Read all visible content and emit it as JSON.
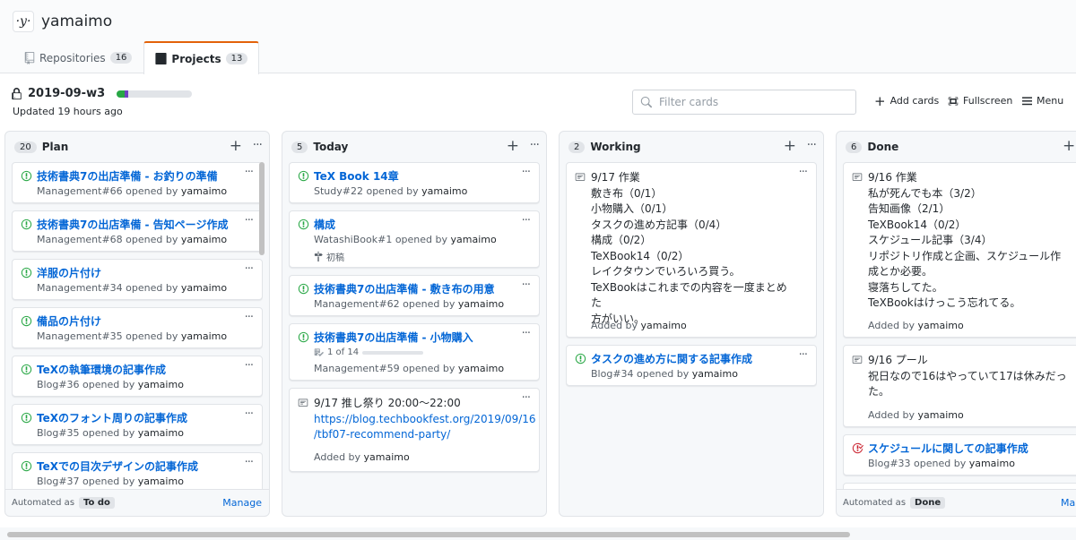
{
  "org": {
    "logo": "·y·",
    "name": "yamaimo"
  },
  "tabs": [
    {
      "label": "Repositories",
      "count": "16",
      "icon": "repo-icon"
    },
    {
      "label": "Projects",
      "count": "13",
      "icon": "project-icon"
    }
  ],
  "project": {
    "name": "2019-09-w3",
    "updated": "Updated 19 hours ago",
    "progress_done_pct": 10,
    "progress_in_progress_pct": 5,
    "colors": {
      "done": "#28a745",
      "in_progress": "#6f42c1",
      "accent": "#e36209",
      "link": "#0366d6",
      "open_issue": "#28a745",
      "closed_issue": "#cb2431"
    }
  },
  "toolbar": {
    "filter_placeholder": "Filter cards",
    "add_cards": "Add cards",
    "fullscreen": "Fullscreen",
    "menu": "Menu"
  },
  "columns": [
    {
      "name": "Plan",
      "count": "20",
      "footer_label": "Automated as",
      "footer_tag": "To do",
      "footer_link": "Manage",
      "cards": [
        {
          "title": "技術書典7の出店準備 - お釣りの準備",
          "ref": "Management#66 opened by",
          "user": "yamaimo"
        },
        {
          "title": "技術書典7の出店準備 - 告知ページ作成",
          "ref": "Management#68 opened by",
          "user": "yamaimo"
        },
        {
          "title": "洋服の片付け",
          "ref": "Management#34 opened by",
          "user": "yamaimo"
        },
        {
          "title": "備品の片付け",
          "ref": "Management#35 opened by",
          "user": "yamaimo"
        },
        {
          "title": "TeXの執筆環境の記事作成",
          "ref": "Blog#36 opened by",
          "user": "yamaimo"
        },
        {
          "title": "TeXのフォント周りの記事作成",
          "ref": "Blog#35 opened by",
          "user": "yamaimo"
        },
        {
          "title": "TeXでの目次デザインの記事作成",
          "ref": "Blog#37 opened by",
          "user": "yamaimo"
        }
      ]
    },
    {
      "name": "Today",
      "count": "5",
      "cards": [
        {
          "title": "TeX Book 14章",
          "ref": "Study#22 opened by",
          "user": "yamaimo"
        },
        {
          "title": "構成",
          "ref": "WatashiBook#1 opened by",
          "user": "yamaimo",
          "milestone": "初稿"
        },
        {
          "title": "技術書典7の出店準備 - 敷き布の用意",
          "ref": "Management#62 opened by",
          "user": "yamaimo"
        },
        {
          "title": "技術書典7の出店準備 - 小物購入",
          "ref": "Management#59 opened by",
          "user": "yamaimo",
          "tasks": "1 of 14"
        },
        {
          "note_lines": [
            "9/17 推し祭り 20:00〜22:00"
          ],
          "link_lines": [
            "https://blog.techbookfest.org/2019/09/16",
            "/tbf07-recommend-party/"
          ],
          "added": "Added by",
          "user": "yamaimo"
        }
      ]
    },
    {
      "name": "Working",
      "count": "2",
      "cards": [
        {
          "note_lines": [
            "9/17 作業",
            "敷き布（0/1）",
            "小物購入（0/1）",
            "タスクの進め方記事（0/4）",
            "構成（0/2）",
            "TeXBook14（0/2）",
            "レイクタウンでいろいろ買う。",
            "TeXBookはこれまでの内容を一度まとめた",
            "方がいい。"
          ],
          "added": "Added by",
          "user": "yamaimo"
        },
        {
          "title": "タスクの進め方に関する記事作成",
          "ref": "Blog#34 opened by",
          "user": "yamaimo"
        }
      ]
    },
    {
      "name": "Done",
      "count": "6",
      "footer_label": "Automated as",
      "footer_tag": "Done",
      "footer_link": "Mar",
      "cards": [
        {
          "note_lines": [
            "9/16 作業",
            "私が死んでも本（3/2）",
            "告知画像（2/1）",
            "TeXBook14（0/2）",
            "スケジュール記事（3/4）",
            "リポジトリ作成と企画、スケジュール作",
            "成とか必要。",
            "寝落ちしてた。",
            "TeXBookはけっこう忘れてる。"
          ],
          "added": "Added by",
          "user": "yamaimo"
        },
        {
          "note_lines": [
            "9/16 プール",
            "祝日なので16はやっていて17は休みだっ",
            "た。"
          ],
          "added": "Added by",
          "user": "yamaimo"
        },
        {
          "title": "スケジュールに関しての記事作成",
          "ref": "Blog#33 opened by",
          "user": "yamaimo",
          "closed": true
        }
      ]
    }
  ]
}
